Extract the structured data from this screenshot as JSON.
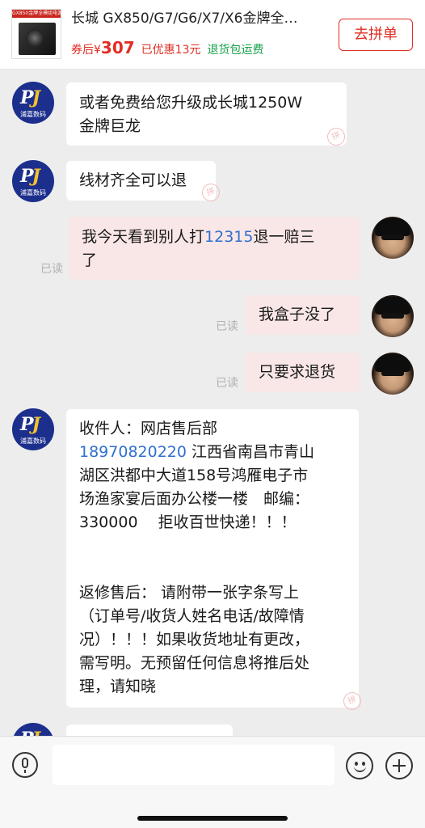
{
  "product": {
    "title": "长城 GX850/G7/G6/X7/X6金牌全…",
    "price_prefix": "券后¥",
    "price": "307",
    "discount": "已优惠13元",
    "return_policy": "退货包运费",
    "thumbnail_caption": "GX850金牌全模组电源",
    "group_buy_label": "去拼单"
  },
  "shop": {
    "avatar_mark": "PJ",
    "avatar_name": "浦嘉数码"
  },
  "messages": [
    {
      "from": "shop",
      "lines": [
        "或者免费给您升级成长城1250W",
        "金牌巨龙"
      ]
    },
    {
      "from": "shop",
      "lines": [
        "线材齐全可以退"
      ]
    },
    {
      "from": "user",
      "pre": "我今天看到别人打",
      "phone": "12315",
      "post": "退一赔三",
      "line2": "了",
      "read": "已读"
    },
    {
      "from": "user",
      "lines": [
        "我盒子没了"
      ],
      "read": "已读"
    },
    {
      "from": "user",
      "lines": [
        "只要求退货"
      ],
      "read": "已读"
    },
    {
      "from": "shop",
      "line1": "收件人：网店售后部",
      "phone": "18970820220",
      "line2_post": " 江西省南昌市青山",
      "lines_rest": [
        "湖区洪都中大道158号鸿雁电子市",
        "场渔家宴后面办公楼一楼　邮编：",
        "330000　 拒收百世快递！！！"
      ],
      "lines_after_gap": [
        "返修售后： 请附带一张字条写上",
        "（订单号/收货人姓名电话/故障情",
        "况）！！！如果收货地址有更改，",
        "需写明。无预留任何信息将推后处",
        "理，请知晓"
      ]
    }
  ],
  "input": {
    "placeholder": ""
  }
}
